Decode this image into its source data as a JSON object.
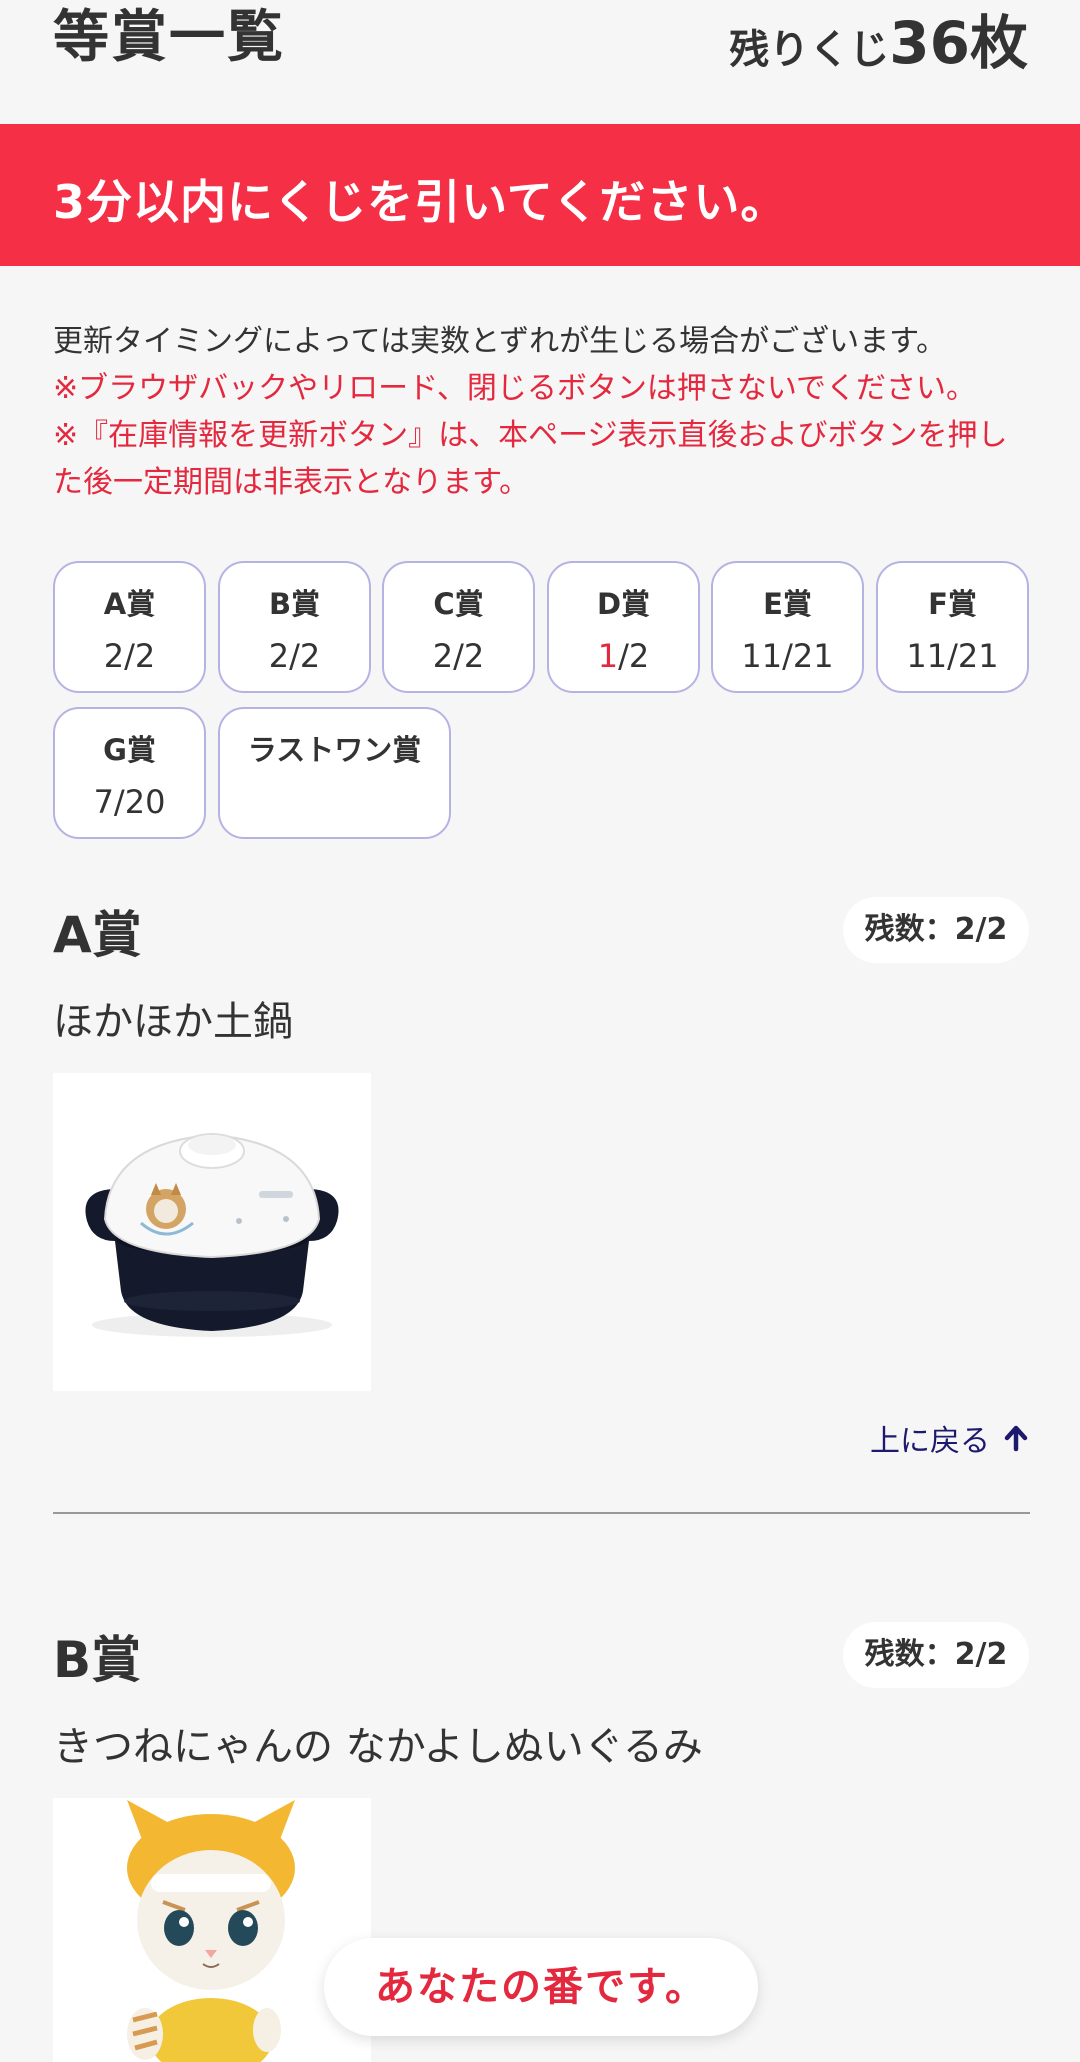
{
  "header": {
    "title": "等賞一覧",
    "remaining_label": "残りくじ",
    "remaining_count": "36枚"
  },
  "banner": {
    "text": "3分以内にくじを引いてください。"
  },
  "notes": {
    "line1": "更新タイミングによっては実数とずれが生じる場合がございます。",
    "line2": "※ブラウザバックやリロード、閉じるボタンは押さないでください。",
    "line3": "※『在庫情報を更新ボタン』は、本ページ表示直後およびボタンを押した後一定期間は非表示となります。"
  },
  "prize_tabs": [
    {
      "name": "A賞",
      "count": "2/2"
    },
    {
      "name": "B賞",
      "count": "2/2"
    },
    {
      "name": "C賞",
      "count": "2/2"
    },
    {
      "name": "D賞",
      "count_highlight": "1",
      "count_rest": "/2"
    },
    {
      "name": "E賞",
      "count": "11/21"
    },
    {
      "name": "F賞",
      "count": "11/21"
    },
    {
      "name": "G賞",
      "count": "7/20"
    },
    {
      "name": "ラストワン賞",
      "count": ""
    }
  ],
  "sections": [
    {
      "title": "A賞",
      "remaining": "残数：2/2",
      "item_name": "ほかほか土鍋"
    },
    {
      "title": "B賞",
      "remaining": "残数：2/2",
      "item_name": "きつねにゃんの なかよしぬいぐるみ"
    }
  ],
  "back_to_top": {
    "label": "上に戻る",
    "icon": "arrow-up-icon"
  },
  "your_turn": {
    "label": "あなたの番です。"
  },
  "colors": {
    "accent_red": "#f52f45",
    "text_red": "#e4283e",
    "tab_border": "#b5b3e3",
    "link_navy": "#1d1a6e"
  }
}
